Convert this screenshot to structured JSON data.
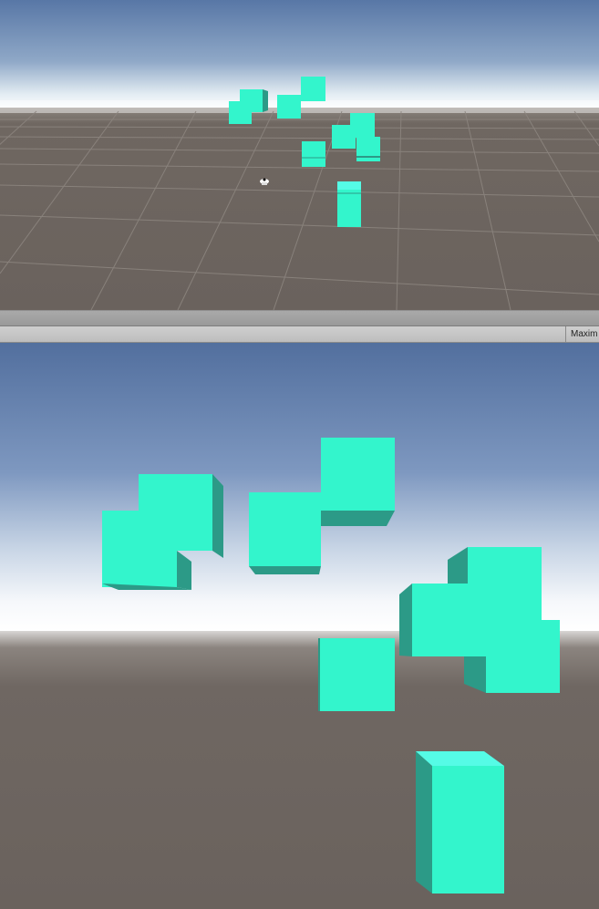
{
  "window": {
    "upper_panel": "scene-view",
    "lower_panel": "game-view"
  },
  "game_toolbar": {
    "maximize_label": "Maxim"
  },
  "colors": {
    "sky_top": "#4f6c9a",
    "horizon_glow": "#ffffff",
    "ground": "#6a625d",
    "cube_front": "#33f5cc",
    "cube_side": "#2c9a87",
    "cube_top": "#55fbe6",
    "grid_line": "#8c8580",
    "toolbar_bg": "#c6c6c6",
    "splitter_bg": "#a3a3a3"
  },
  "icons": {
    "light_gizmo": "light-icon"
  }
}
